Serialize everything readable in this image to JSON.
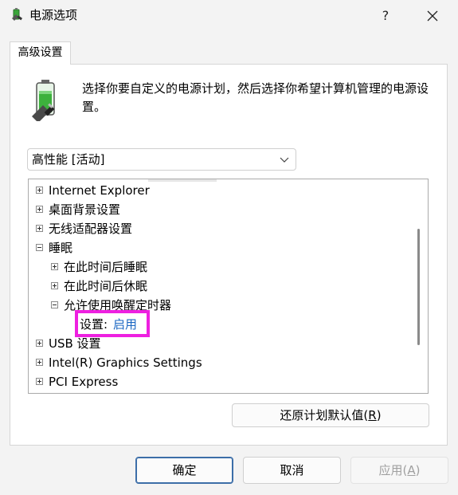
{
  "window": {
    "title": "电源选项",
    "help": "?"
  },
  "tabs": [
    {
      "label": "高级设置"
    }
  ],
  "description": "选择你要自定义的电源计划，然后选择你希望计算机管理的电源设置。",
  "plan_select": {
    "value": "高性能 [活动]"
  },
  "tree": {
    "items": [
      {
        "label": "Internet Explorer",
        "state": "collapsed"
      },
      {
        "label": "桌面背景设置",
        "state": "collapsed"
      },
      {
        "label": "无线适配器设置",
        "state": "collapsed"
      },
      {
        "label": "睡眠",
        "state": "expanded"
      },
      {
        "label": "在此时间后睡眠",
        "state": "collapsed"
      },
      {
        "label": "在此时间后休眠",
        "state": "collapsed"
      },
      {
        "label": "允许使用唤醒定时器",
        "state": "expanded"
      },
      {
        "label": "USB 设置",
        "state": "collapsed"
      },
      {
        "label": "Intel(R) Graphics Settings",
        "state": "collapsed"
      },
      {
        "label": "PCI Express",
        "state": "collapsed"
      }
    ],
    "setting": {
      "label": "设置:",
      "value": "启用"
    }
  },
  "buttons": {
    "restore": {
      "text": "还原计划默认值(",
      "key": "R",
      "suffix": ")"
    },
    "ok": "确定",
    "cancel": "取消",
    "apply": {
      "text": "应用(",
      "key": "A",
      "suffix": ")"
    }
  },
  "colors": {
    "highlight": "#ee20e0",
    "link": "#1a66c2",
    "accent_border": "#3c6ea8"
  }
}
